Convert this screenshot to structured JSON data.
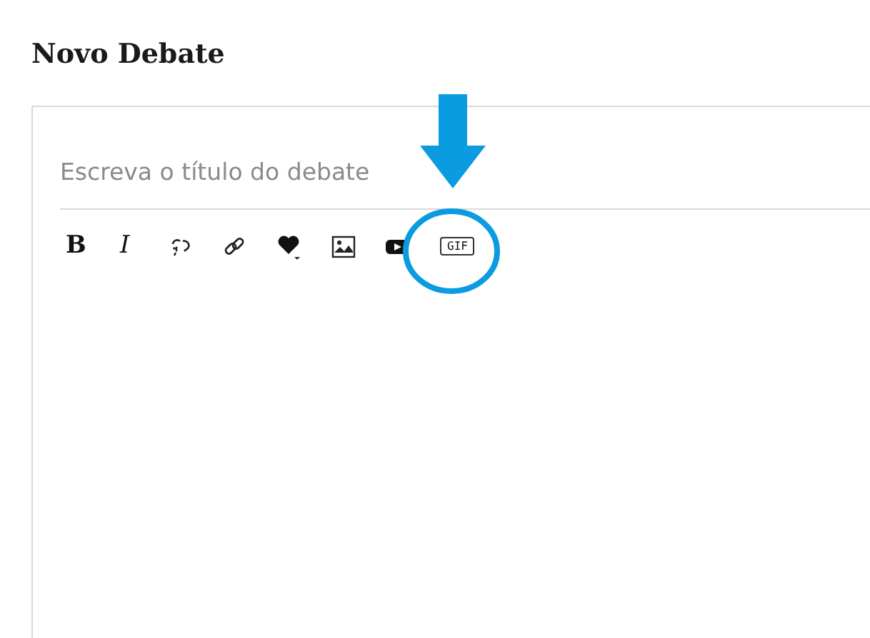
{
  "heading": "Novo Debate",
  "title_field": {
    "placeholder": "Escreva o título do debate"
  },
  "toolbar": [
    {
      "kind": "bold",
      "label": "B"
    },
    {
      "kind": "italic",
      "label": "I"
    },
    {
      "kind": "unlink"
    },
    {
      "kind": "link"
    },
    {
      "kind": "emoji"
    },
    {
      "kind": "image"
    },
    {
      "kind": "video"
    },
    {
      "kind": "gif",
      "label": "GIF"
    }
  ]
}
